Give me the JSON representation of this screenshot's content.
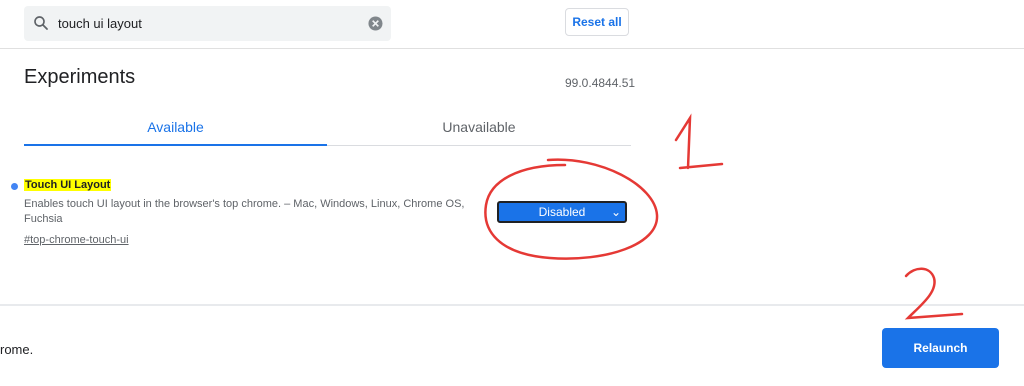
{
  "search": {
    "value": "touch ui layout"
  },
  "toolbar": {
    "reset_label": "Reset all"
  },
  "header": {
    "title": "Experiments",
    "version": "99.0.4844.51"
  },
  "tabs": [
    {
      "label": "Available"
    },
    {
      "label": "Unavailable"
    }
  ],
  "experiment": {
    "title": "Touch UI Layout",
    "description": "Enables touch UI layout in the browser's top chrome. – Mac, Windows, Linux, Chrome OS, Fuchsia",
    "link": "#top-chrome-touch-ui",
    "selected_option": "Disabled"
  },
  "footer": {
    "text": "rome.",
    "relaunch_label": "Relaunch"
  },
  "annotations": {
    "label_1": "1",
    "label_2": "2",
    "color": "#e53935"
  },
  "colors": {
    "accent": "#1a73e8",
    "highlight": "#ffff00"
  }
}
